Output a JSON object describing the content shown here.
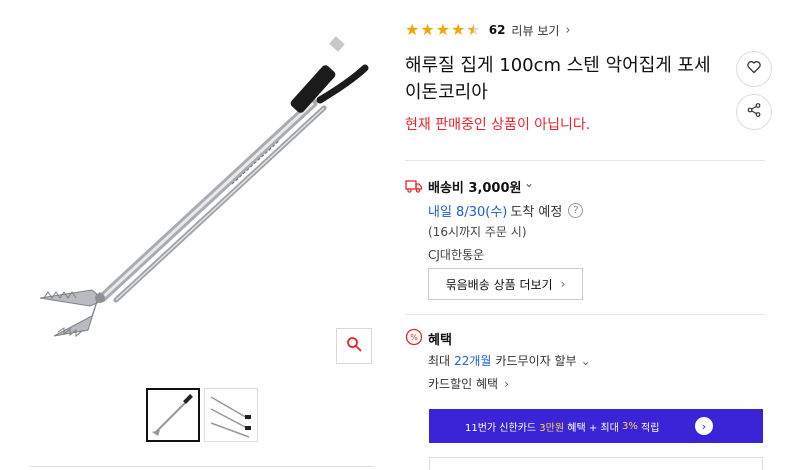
{
  "rating": {
    "value": 4.5,
    "review_count": "62",
    "review_label": "리뷰 보기"
  },
  "product": {
    "title": "해루질 집게 100cm 스텐 악어집게 포세이돈코리아",
    "status": "현재 판매중인 상품이 아닙니다."
  },
  "shipping": {
    "fee": "배송비 3,000원",
    "arrival_date": "내일 8/30(수)",
    "arrival_suffix": "도착 예정",
    "cutoff": "(16시까지 주문 시)",
    "carrier": "CJ대한통운",
    "bundle_button": "묶음배송 상품 더보기"
  },
  "benefits": {
    "title": "혜택",
    "installment_prefix": "최대",
    "installment_months": "22개월",
    "installment_suffix": "카드무이자 할부",
    "card_discount": "카드할인 혜택"
  },
  "banner": {
    "part1": "11번가 신한카드",
    "amount": "3만원",
    "part2": "혜택 + 최대",
    "rate": "3%",
    "part3": "적립"
  },
  "icons": {
    "zoom": "search-icon",
    "wishlist": "heart-icon",
    "share": "share-icon",
    "shipping": "truck-icon",
    "benefit": "percent-badge-icon"
  },
  "colors": {
    "star": "#f7a600",
    "status_red": "#e8262b",
    "link_blue": "#1a5ed8",
    "banner_bg": "#3b23d8",
    "banner_highlight": "#ffd84a"
  }
}
